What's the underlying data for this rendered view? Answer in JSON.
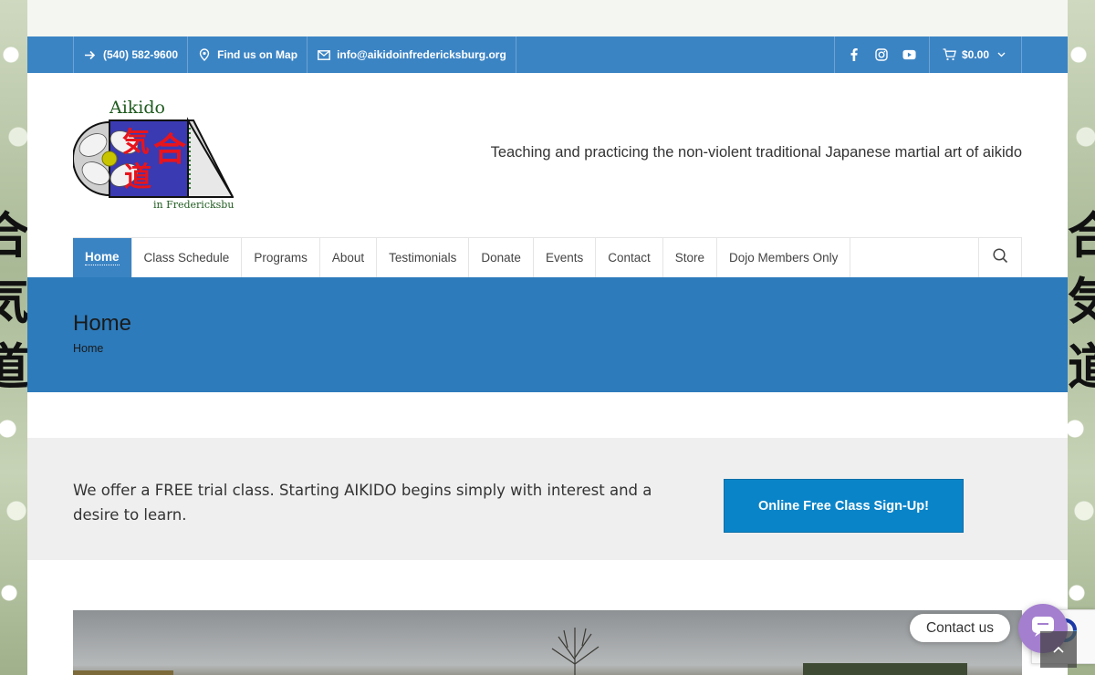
{
  "topbar": {
    "phone": "(540) 582-9600",
    "map": "Find us on Map",
    "email": "info@aikidoinfredericksburg.org",
    "social": [
      "facebook-icon",
      "instagram-icon",
      "youtube-icon"
    ],
    "cart_total": "$0.00",
    "bg_color": "#3b84c4"
  },
  "header": {
    "logo_title": "Aikido",
    "logo_subtitle": "in Fredericksburg",
    "tagline": "Teaching and practicing the non-violent traditional Japanese martial art of aikido"
  },
  "nav": {
    "items": [
      "Home",
      "Class Schedule",
      "Programs",
      "About",
      "Testimonials",
      "Donate",
      "Events",
      "Contact",
      "Store",
      "Dojo Members Only"
    ],
    "active": "Home"
  },
  "banner": {
    "title": "Home",
    "breadcrumb": "Home",
    "bg_color": "#2d7bbb"
  },
  "promo": {
    "text": "We offer a FREE trial class. Starting AIKIDO begins simply with interest and a desire to learn.",
    "button": "Online Free Class Sign-Up!",
    "button_color": "#0a84c8"
  },
  "widget": {
    "contact_label": "Contact us",
    "bubble_color": "#a47fcf"
  },
  "background": {
    "kanji_left": "合\n気\n道",
    "kanji_right": "合\n気\n道"
  }
}
